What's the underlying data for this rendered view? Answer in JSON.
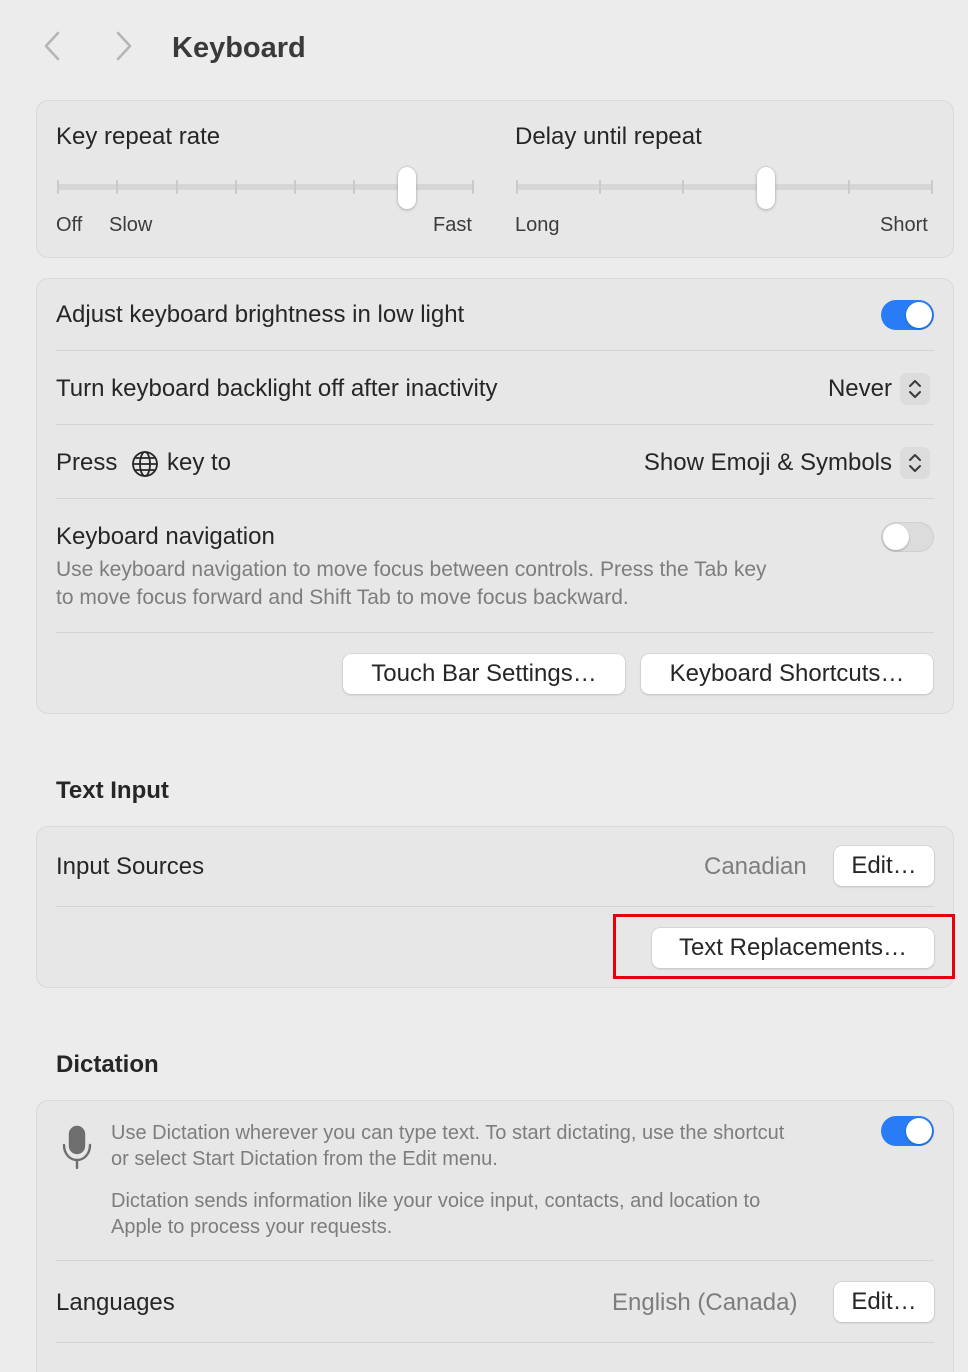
{
  "header": {
    "title": "Keyboard",
    "back_icon": "chevron-left-icon",
    "forward_icon": "chevron-right-icon"
  },
  "repeat": {
    "key_repeat_rate": {
      "title": "Key repeat rate",
      "min_labels": [
        "Off",
        "Slow"
      ],
      "max_label": "Fast",
      "ticks": 8,
      "value_fraction": 0.84
    },
    "delay_until_repeat": {
      "title": "Delay until repeat",
      "min_label": "Long",
      "max_label": "Short",
      "ticks": 6,
      "value_fraction": 0.6
    }
  },
  "settings": {
    "brightness": {
      "label": "Adjust keyboard brightness in low light",
      "on": true
    },
    "backlight": {
      "label": "Turn keyboard backlight off after inactivity",
      "value": "Never"
    },
    "globe_key": {
      "label_before": "Press",
      "label_after": "key to",
      "icon": "globe-icon",
      "value": "Show Emoji & Symbols"
    },
    "keyboard_navigation": {
      "label": "Keyboard navigation",
      "description_line1": "Use keyboard navigation to move focus between controls. Press the Tab key",
      "description_line2": "to move focus forward and Shift Tab to move focus backward.",
      "on": false
    },
    "touch_bar_button": "Touch Bar Settings…",
    "shortcuts_button": "Keyboard Shortcuts…"
  },
  "text_input": {
    "title": "Text Input",
    "input_sources_label": "Input Sources",
    "input_sources_value": "Canadian",
    "edit_button": "Edit…",
    "text_replacements_button": "Text Replacements…"
  },
  "dictation": {
    "title": "Dictation",
    "icon": "microphone-icon",
    "description_line1": "Use Dictation wherever you can type text. To start dictating, use the shortcut",
    "description_line2": "or select Start Dictation from the Edit menu.",
    "privacy_line1": "Dictation sends information like your voice input, contacts, and location to",
    "privacy_line2": "Apple to process your requests.",
    "on": true,
    "languages_label": "Languages",
    "languages_value": "English (Canada)",
    "edit_button": "Edit…"
  },
  "colors": {
    "accent": "#2a7cf6",
    "highlight": "#e8000b",
    "background": "#ececec"
  }
}
